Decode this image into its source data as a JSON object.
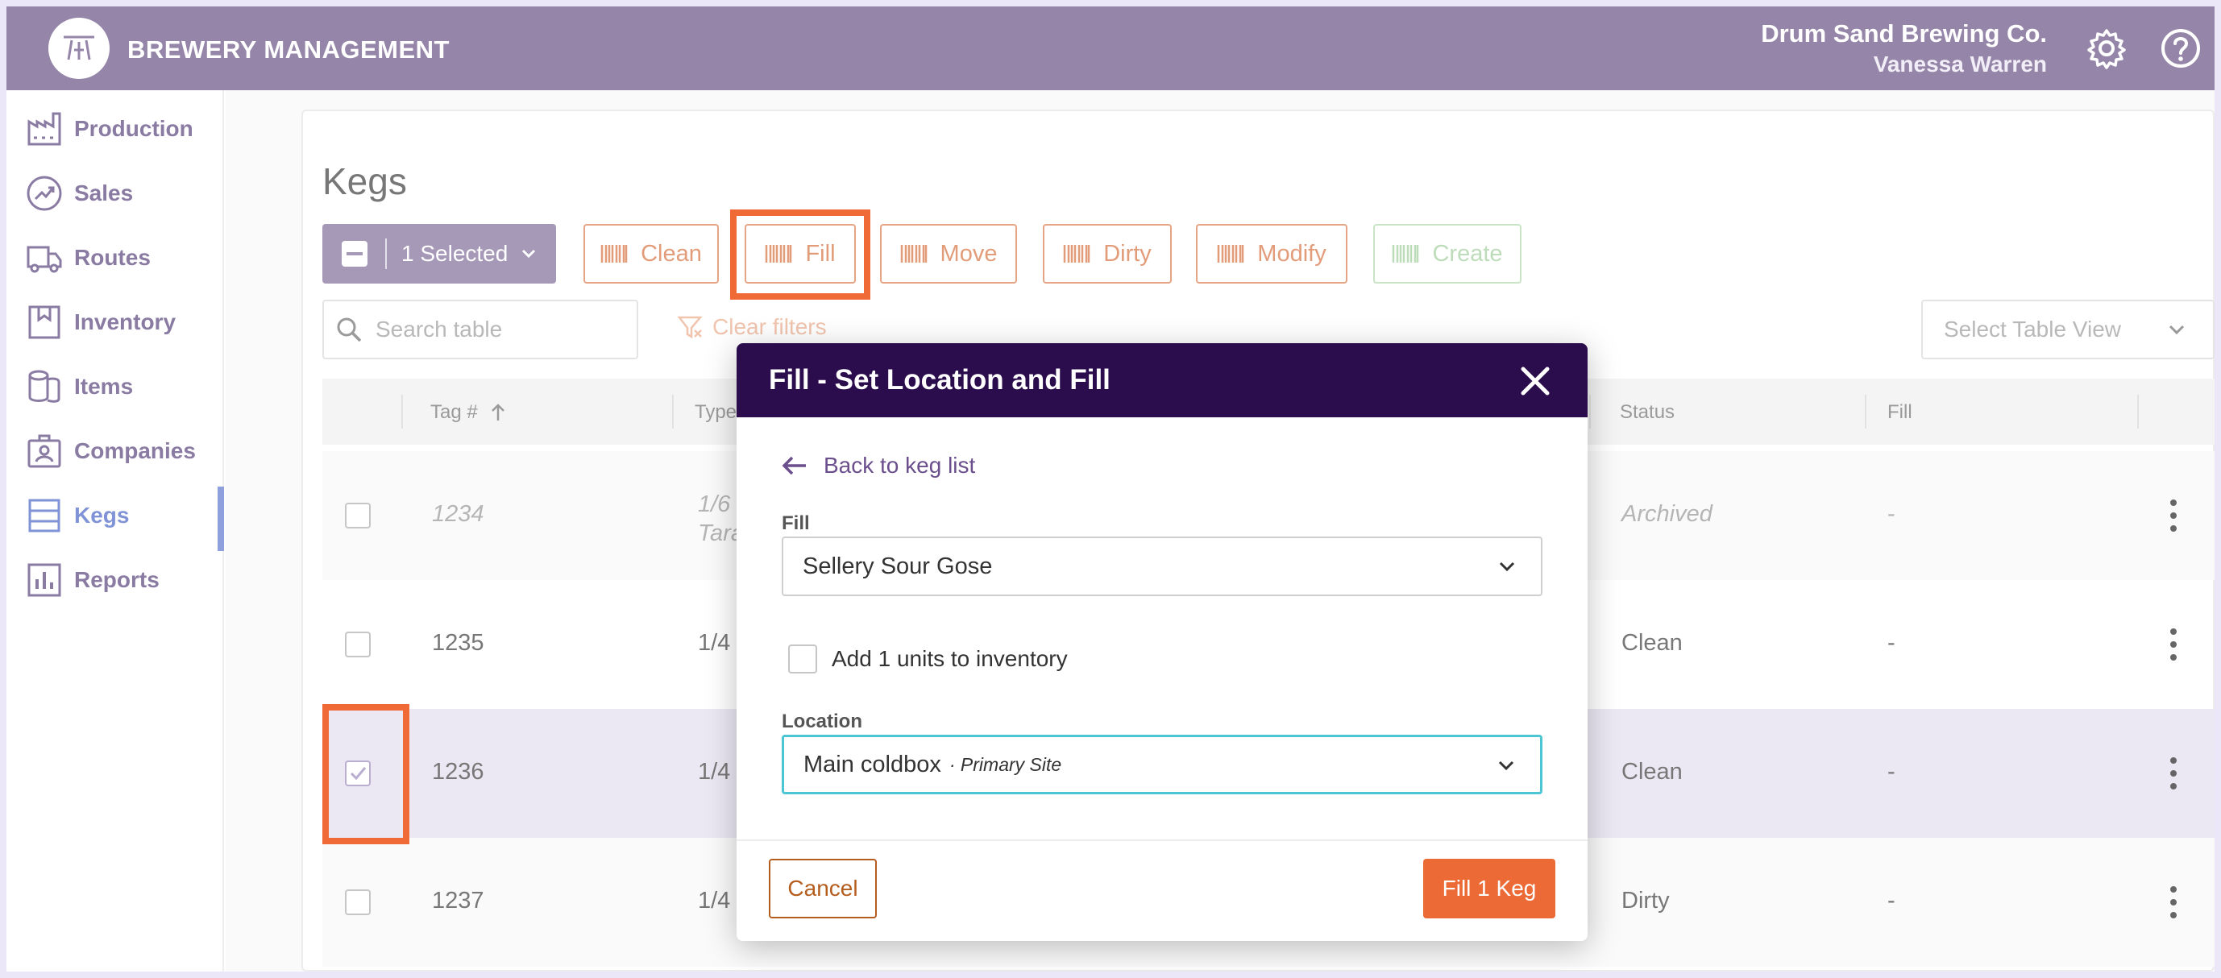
{
  "header": {
    "app_title": "BREWERY MANAGEMENT",
    "company_name": "Drum Sand Brewing Co.",
    "user_name": "Vanessa Warren",
    "bg_color": "#9585a8"
  },
  "sidebar": {
    "items": [
      {
        "label": "Production",
        "icon": "factory-icon"
      },
      {
        "label": "Sales",
        "icon": "trend-chart-icon"
      },
      {
        "label": "Routes",
        "icon": "truck-icon"
      },
      {
        "label": "Inventory",
        "icon": "inventory-box-icon"
      },
      {
        "label": "Items",
        "icon": "barrels-icon"
      },
      {
        "label": "Companies",
        "icon": "badge-icon"
      },
      {
        "label": "Kegs",
        "icon": "keg-stack-icon",
        "active": true
      },
      {
        "label": "Reports",
        "icon": "bar-chart-icon"
      }
    ]
  },
  "page": {
    "title": "Kegs",
    "selected_label": "1 Selected",
    "actions": [
      "Clean",
      "Fill",
      "Move",
      "Dirty",
      "Modify",
      "Create"
    ],
    "search_placeholder": "Search table",
    "clear_filters": "Clear filters",
    "table_view_placeholder": "Select Table View"
  },
  "table": {
    "columns": [
      "Tag #",
      "Type",
      "Status",
      "Fill"
    ],
    "rows": [
      {
        "tag": "1234",
        "type_line1": "1/6",
        "type_line2": "Tara",
        "status": "Archived",
        "fill": "-",
        "checked": false
      },
      {
        "tag": "1235",
        "type_line1": "1/4",
        "type_line2": "",
        "status": "Clean",
        "fill": "-",
        "checked": false
      },
      {
        "tag": "1236",
        "type_line1": "1/4",
        "type_line2": "",
        "status": "Clean",
        "fill": "-",
        "checked": true
      },
      {
        "tag": "1237",
        "type_line1": "1/4",
        "type_line2": "",
        "status": "Dirty",
        "fill": "-",
        "checked": false
      }
    ]
  },
  "modal": {
    "title": "Fill - Set Location and Fill",
    "back_link": "Back to keg list",
    "fill_label": "Fill",
    "fill_value": "Sellery Sour Gose",
    "inventory_checkbox_label": "Add 1 units to inventory",
    "location_label": "Location",
    "location_value": "Main coldbox",
    "location_site": "· Primary Site",
    "cancel_label": "Cancel",
    "submit_label": "Fill 1 Keg",
    "accent_color": "#ec6a35"
  }
}
